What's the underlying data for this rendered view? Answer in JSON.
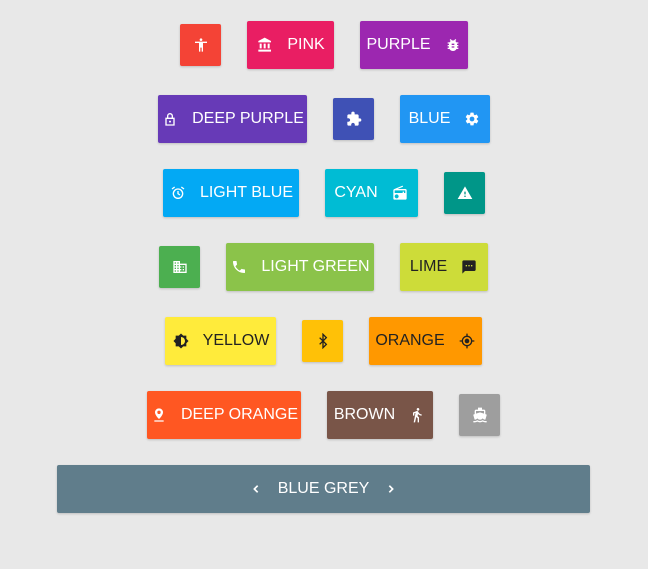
{
  "colors": {
    "red": "#f44336",
    "pink": "#e91e63",
    "purple": "#9c27b0",
    "deep_purple": "#673ab7",
    "indigo": "#3f51b5",
    "blue": "#2196f3",
    "light_blue": "#03a9f4",
    "cyan": "#00bcd4",
    "teal": "#009688",
    "green": "#4caf50",
    "light_green": "#8bc34a",
    "lime": "#cddc39",
    "yellow": "#ffeb3b",
    "amber": "#ffc107",
    "orange": "#ff9800",
    "deep_orange": "#ff5722",
    "brown": "#795548",
    "grey": "#9e9e9e",
    "blue_grey": "#607d8b"
  },
  "buttons": {
    "red": {
      "icon": "accessibility-icon"
    },
    "pink": {
      "label": "PINK",
      "icon": "bank-icon"
    },
    "purple": {
      "label": "PURPLE",
      "icon": "bug-icon"
    },
    "deep_purple": {
      "label": "DEEP PURPLE",
      "icon": "lock-open-icon"
    },
    "indigo": {
      "icon": "extension-icon"
    },
    "blue": {
      "label": "BLUE",
      "icon": "gear-icon"
    },
    "light_blue": {
      "label": "LIGHT BLUE",
      "icon": "alarm-icon"
    },
    "cyan": {
      "label": "CYAN",
      "icon": "radio-icon"
    },
    "teal": {
      "icon": "warning-icon"
    },
    "green": {
      "icon": "business-icon"
    },
    "light_green": {
      "label": "LIGHT GREEN",
      "icon": "phone-icon"
    },
    "lime": {
      "label": "LIME",
      "icon": "chat-icon"
    },
    "yellow": {
      "label": "YELLOW",
      "icon": "brightness-icon"
    },
    "amber": {
      "icon": "bluetooth-icon"
    },
    "orange": {
      "label": "ORANGE",
      "icon": "gps-icon"
    },
    "deep_orange": {
      "label": "DEEP ORANGE",
      "icon": "location-icon"
    },
    "brown": {
      "label": "BROWN",
      "icon": "walk-icon"
    },
    "grey": {
      "icon": "boat-icon"
    },
    "blue_grey": {
      "label": "BLUE GREY",
      "icon_left": "chevron-left-icon",
      "icon_right": "chevron-right-icon"
    }
  }
}
